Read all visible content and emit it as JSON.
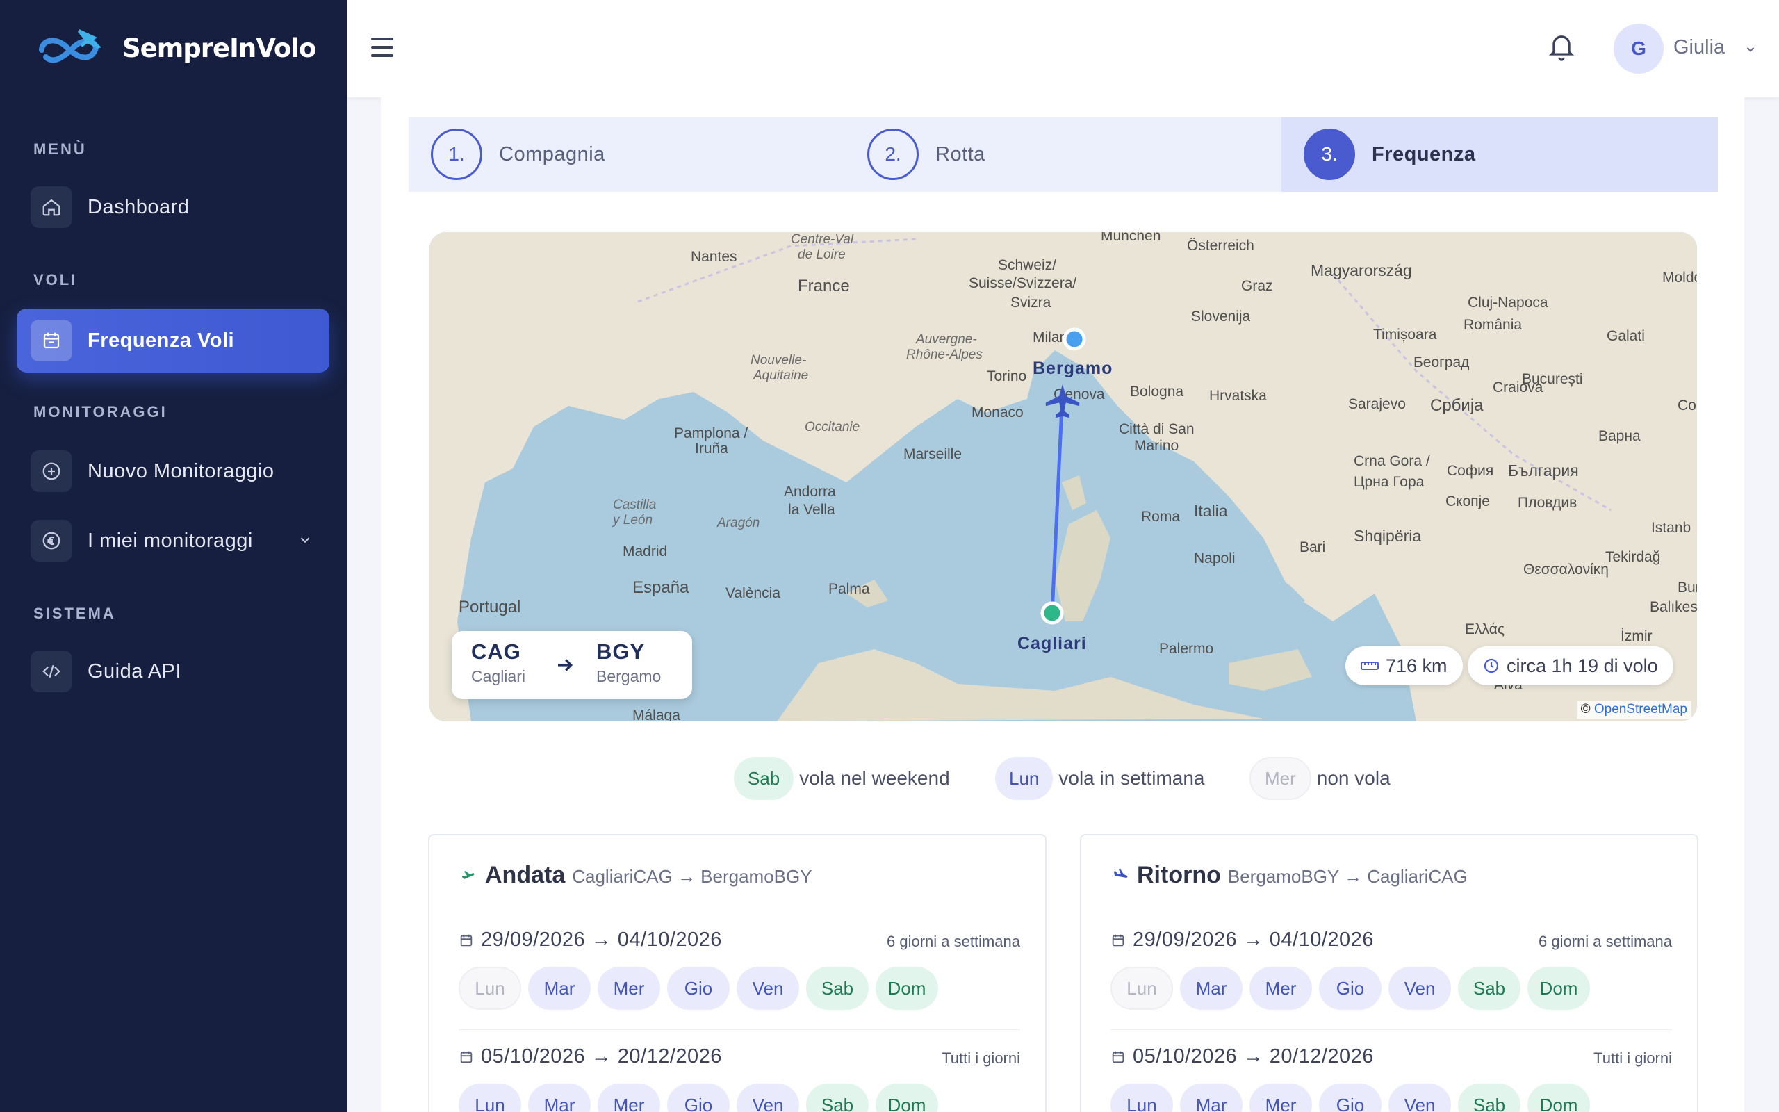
{
  "brand": {
    "name": "SempreInVolo"
  },
  "sidebar": {
    "sections": {
      "menu": "MENÙ",
      "voli": "VOLI",
      "monitoraggi": "MONITORAGGI",
      "sistema": "SISTEMA"
    },
    "items": {
      "dashboard": "Dashboard",
      "frequenza_voli": "Frequenza Voli",
      "nuovo_monitoraggio": "Nuovo Monitoraggio",
      "miei_monitoraggi": "I miei monitoraggi",
      "guida_api": "Guida API"
    }
  },
  "header": {
    "avatar_initial": "G",
    "user_name": "Giulia"
  },
  "steps": [
    {
      "num": "1.",
      "label": "Compagnia"
    },
    {
      "num": "2.",
      "label": "Rotta"
    },
    {
      "num": "3.",
      "label": "Frequenza",
      "active": true
    }
  ],
  "map": {
    "origin": {
      "code": "CAG",
      "city": "Cagliari"
    },
    "destination": {
      "code": "BGY",
      "city": "Bergamo"
    },
    "distance": "716 km",
    "duration": "circa 1h 19 di volo",
    "attribution_prefix": "©",
    "attribution_link": "OpenStreetMap",
    "place_labels": [
      "Nantes",
      "Centre-Val",
      "de Loire",
      "France",
      "Schweiz/",
      "Suisse/Svizzera/",
      "Svizra",
      "München",
      "Österreich",
      "Magyarország",
      "Moldo",
      "Graz",
      "Slovenija",
      "Cluj-Napoca",
      "România",
      "Galati",
      "Timișoara",
      "Београд",
      "București",
      "Craiova",
      "Co",
      "Варна",
      "Auvergne-",
      "Rhône-Alpes",
      "Nouvelle-",
      "Aquitaine",
      "Torino",
      "Milano",
      "Genova",
      "Bologna",
      "Hrvatska",
      "Sarajevo",
      "Србија",
      "Monaco",
      "Città di San",
      "Marino",
      "Pamplona /",
      "Iruña",
      "Occitanie",
      "Marseille",
      "Andorra",
      "la Vella",
      "Crna Gora /",
      "Црна Гора",
      "София",
      "България",
      "Скопје",
      "Пловдив",
      "Istanb",
      "Castilla",
      "y León",
      "Aragón",
      "Roma",
      "Italia",
      "Shqipëria",
      "Tekirdağ",
      "Madrid",
      "España",
      "València",
      "Palma",
      "Napoli",
      "Bari",
      "Θεσσαλονίκη",
      "Burs",
      "Balıkesir",
      "Portugal",
      "Palermo",
      "Ελλάς",
      "İzmir",
      "Málaga",
      "Aiva",
      "Bergamo",
      "Cagliari"
    ]
  },
  "legend": [
    {
      "chip": "Sab",
      "text": "vola nel weekend",
      "kind": "weekend"
    },
    {
      "chip": "Lun",
      "text": "vola in settimana",
      "kind": "weekday"
    },
    {
      "chip": "Mer",
      "text": "non vola",
      "kind": "off"
    }
  ],
  "outbound": {
    "title": "Andata",
    "route": "CagliariCAG → BergamoBGY",
    "periods": [
      {
        "dates": "29/09/2026 → 04/10/2026",
        "count": "6 giorni a settimana",
        "days": [
          {
            "d": "Lun",
            "s": "off"
          },
          {
            "d": "Mar",
            "s": "wd"
          },
          {
            "d": "Mer",
            "s": "wd"
          },
          {
            "d": "Gio",
            "s": "wd"
          },
          {
            "d": "Ven",
            "s": "wd"
          },
          {
            "d": "Sab",
            "s": "we"
          },
          {
            "d": "Dom",
            "s": "we"
          }
        ]
      },
      {
        "dates": "05/10/2026 → 20/12/2026",
        "count": "Tutti i giorni",
        "days": [
          {
            "d": "Lun",
            "s": "wd"
          },
          {
            "d": "Mar",
            "s": "wd"
          },
          {
            "d": "Mer",
            "s": "wd"
          },
          {
            "d": "Gio",
            "s": "wd"
          },
          {
            "d": "Ven",
            "s": "wd"
          },
          {
            "d": "Sab",
            "s": "we"
          },
          {
            "d": "Dom",
            "s": "we"
          }
        ]
      }
    ]
  },
  "return": {
    "title": "Ritorno",
    "route": "BergamoBGY → CagliariCAG",
    "periods": [
      {
        "dates": "29/09/2026 → 04/10/2026",
        "count": "6 giorni a settimana",
        "days": [
          {
            "d": "Lun",
            "s": "off"
          },
          {
            "d": "Mar",
            "s": "wd"
          },
          {
            "d": "Mer",
            "s": "wd"
          },
          {
            "d": "Gio",
            "s": "wd"
          },
          {
            "d": "Ven",
            "s": "wd"
          },
          {
            "d": "Sab",
            "s": "we"
          },
          {
            "d": "Dom",
            "s": "we"
          }
        ]
      },
      {
        "dates": "05/10/2026 → 20/12/2026",
        "count": "Tutti i giorni",
        "days": [
          {
            "d": "Lun",
            "s": "wd"
          },
          {
            "d": "Mar",
            "s": "wd"
          },
          {
            "d": "Mer",
            "s": "wd"
          },
          {
            "d": "Gio",
            "s": "wd"
          },
          {
            "d": "Ven",
            "s": "wd"
          },
          {
            "d": "Sab",
            "s": "we"
          },
          {
            "d": "Dom",
            "s": "we"
          }
        ]
      }
    ]
  },
  "colors": {
    "sidebar_bg": "#161f3f",
    "accent": "#4a5bd0",
    "weekend": "#e2f5ec",
    "weekday": "#e9ebfc"
  }
}
